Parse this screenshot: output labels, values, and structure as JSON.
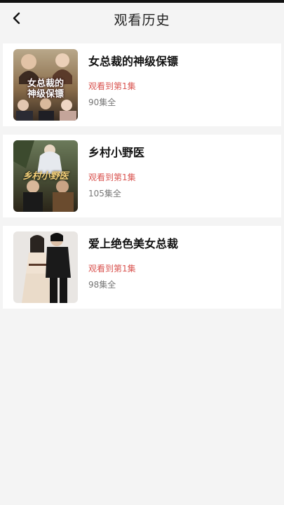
{
  "header": {
    "title": "观看历史",
    "back_icon": "chevron-left-icon"
  },
  "history": [
    {
      "title": "女总裁的神级保镖",
      "progress": "观看到第1集",
      "episodes": "90集全",
      "poster_text": [
        "女总裁的",
        "神级保镖"
      ]
    },
    {
      "title": "乡村小野医",
      "progress": "观看到第1集",
      "episodes": "105集全",
      "poster_text": [
        "乡村小野医"
      ]
    },
    {
      "title": "爱上绝色美女总裁",
      "progress": "观看到第1集",
      "episodes": "98集全",
      "poster_text": []
    }
  ],
  "colors": {
    "progress": "#d9534f",
    "background": "#f4f4f4",
    "card": "#ffffff"
  }
}
